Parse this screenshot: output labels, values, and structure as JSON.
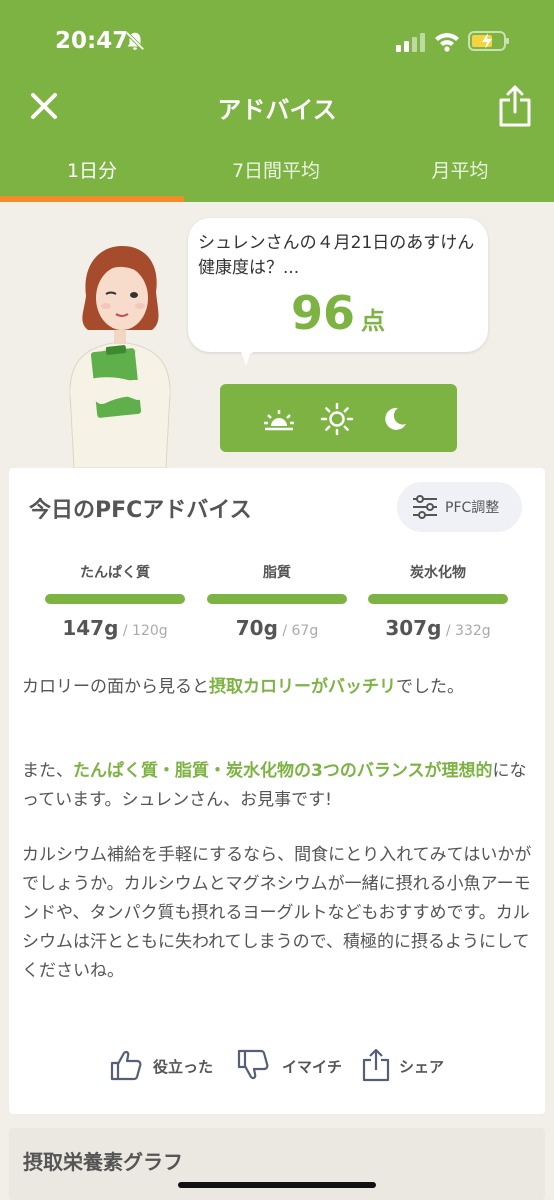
{
  "status": {
    "time": "20:47"
  },
  "nav": {
    "title": "アドバイス"
  },
  "tabs": [
    {
      "label": "1日分"
    },
    {
      "label": "7日間平均"
    },
    {
      "label": "月平均"
    }
  ],
  "bubble": {
    "text": "シュレンさんの４月21日のあすけん健康度は？...",
    "score": "96",
    "score_unit": "点"
  },
  "advice": {
    "title": "今日のPFCアドバイス",
    "pfc_button": "PFC調整",
    "nutrients": [
      {
        "label": "たんぱく質",
        "value": "147g",
        "target": " / 120g"
      },
      {
        "label": "脂質",
        "value": "70g",
        "target": " / 67g"
      },
      {
        "label": "炭水化物",
        "value": "307g",
        "target": " / 332g"
      }
    ],
    "p1_a": "カロリーの面から見ると",
    "p1_hl": "摂取カロリーがバッチリ",
    "p1_b": "でした。",
    "p2_a": "また、",
    "p2_hl": "たんぱく質・脂質・炭水化物の3つのバランスが理想的",
    "p2_b": "になっています。シュレンさん、お見事です!",
    "p3": "カルシウム補給を手軽にするなら、間食にとり入れてみてはいかがでしょうか。カルシウムとマグネシウムが一緒に摂れる小魚アーモンドや、タンパク質も摂れるヨーグルトなどもおすすめです。カルシウムは汗とともに失われてしまうので、積極的に摂るようにしてくださいね。",
    "actions": [
      {
        "label": "役立った"
      },
      {
        "label": "イマイチ"
      },
      {
        "label": "シェア"
      }
    ]
  },
  "section": {
    "title": "摂取栄養素グラフ"
  },
  "colors": {
    "brand_green": "#7cb342",
    "tab_indicator": "#f28c28"
  }
}
